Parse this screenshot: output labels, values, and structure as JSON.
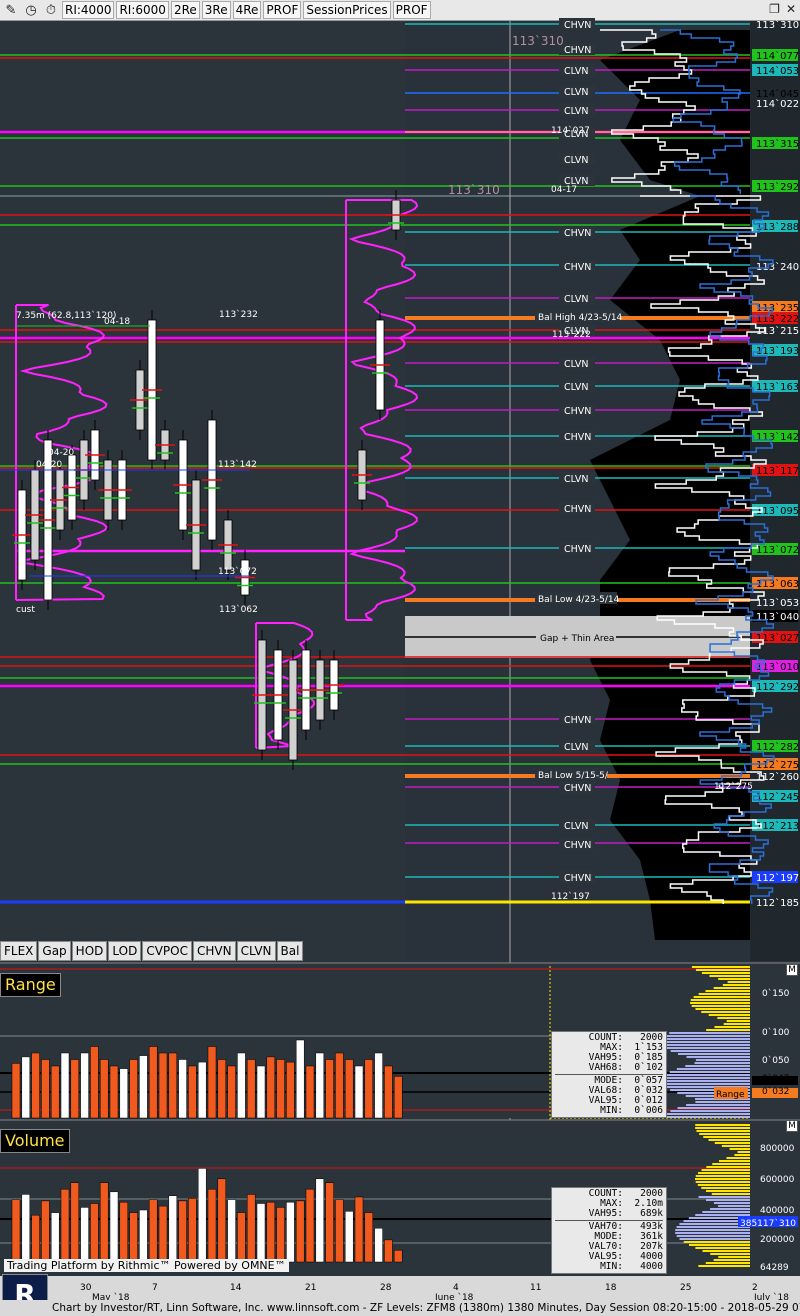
{
  "toolbar": {
    "buttons": [
      "RI:4000",
      "RI:6000",
      "2Re",
      "3Re",
      "4Re",
      "PROF",
      "SessionPrices",
      "PROF"
    ],
    "icons": [
      "pencil-icon",
      "clock-icon",
      "stopwatch-icon"
    ],
    "ri_badge": "RI"
  },
  "bottom_toolbar": [
    "FLEX",
    "Gap",
    "HOD",
    "LOD",
    "CVPOC",
    "CHVN",
    "CLVN",
    "Bal"
  ],
  "price_scale_labels": [
    {
      "t": "113`310",
      "c": "#ffffff",
      "bg": "#2b333b"
    },
    {
      "t": "114`077",
      "c": "#000",
      "bg": "#21c21c"
    },
    {
      "t": "114`053",
      "c": "#000",
      "bg": "#1fb8b8"
    },
    {
      "t": "114`045",
      "c": "#000",
      "bg": "#2b333b"
    },
    {
      "t": "114`022",
      "c": "#fff",
      "bg": "#2b333b"
    },
    {
      "t": "113`315",
      "c": "#000",
      "bg": "#21c21c"
    },
    {
      "t": "113`292",
      "c": "#000",
      "bg": "#21c21c"
    },
    {
      "t": "113`288",
      "c": "#000",
      "bg": "#1fb8b8"
    },
    {
      "t": "113`240",
      "c": "#fff",
      "bg": "#2b333b"
    },
    {
      "t": "113`235",
      "c": "#000",
      "bg": "#f47b1f"
    },
    {
      "t": "113`222",
      "c": "#000",
      "bg": "#e01212"
    },
    {
      "t": "113`215",
      "c": "#fff",
      "bg": "#2b333b"
    },
    {
      "t": "113`193",
      "c": "#000",
      "bg": "#1fb8b8"
    },
    {
      "t": "113`163",
      "c": "#000",
      "bg": "#1fb8b8"
    },
    {
      "t": "113`142",
      "c": "#000",
      "bg": "#21c21c"
    },
    {
      "t": "113`117",
      "c": "#000",
      "bg": "#e01212"
    },
    {
      "t": "113`095",
      "c": "#000",
      "bg": "#1fb8b8"
    },
    {
      "t": "113`072",
      "c": "#000",
      "bg": "#21c21c"
    },
    {
      "t": "113`063",
      "c": "#000",
      "bg": "#f47b1f"
    },
    {
      "t": "113`053",
      "c": "#fff",
      "bg": "#2b333b"
    },
    {
      "t": "113`040",
      "c": "#fff",
      "bg": "#000"
    },
    {
      "t": "113`027",
      "c": "#000",
      "bg": "#e01212"
    },
    {
      "t": "113`010",
      "c": "#000",
      "bg": "#e020e0"
    },
    {
      "t": "112`292",
      "c": "#000",
      "bg": "#1fb8b8"
    },
    {
      "t": "112`282",
      "c": "#000",
      "bg": "#21c21c"
    },
    {
      "t": "112`275",
      "c": "#000",
      "bg": "#f47b1f"
    },
    {
      "t": "112`260",
      "c": "#fff",
      "bg": "#2b333b"
    },
    {
      "t": "112`245",
      "c": "#000",
      "bg": "#1fb8b8"
    },
    {
      "t": "112`213",
      "c": "#000",
      "bg": "#1fb8b8"
    },
    {
      "t": "112`197",
      "c": "#fff",
      "bg": "#1a3cff"
    },
    {
      "t": "112`185",
      "c": "#fff",
      "bg": "#2b333b"
    }
  ],
  "annotations": {
    "poc_label": "7.35m (62.8,113`120)",
    "date_0418": "04-18",
    "date_0420a": "04-20",
    "date_0420b": "04-20",
    "high_232": "113`232",
    "level_142": "113`142",
    "level_072": "113`072",
    "level_062": "113`062",
    "cust": "cust",
    "top_310": "113`310",
    "mid_310": "113`310",
    "d0417": "04-17",
    "bal_high": "Bal High 4/23-5/14",
    "bal_low": "Bal Low 4/23-5/14",
    "gap_thin": "Gap + Thin Area",
    "bal_low2": "Bal Low 5/15-5/",
    "l222": "113`222",
    "l197": "112`197",
    "l275": "112`275",
    "l027": "114`027",
    "june": "June `18"
  },
  "chvn_labels": [
    "CHVN",
    "CHVN",
    "CLVN",
    "CLVN",
    "CLVN",
    "CLVN",
    "CLVN",
    "CLVN",
    "CHVN",
    "CHVN",
    "CLVN",
    "CLVN",
    "CLVN",
    "CLVN",
    "CHVN",
    "CHVN",
    "CLVN",
    "CHVN",
    "CHVN",
    "CHVN",
    "CLVN",
    "CHVN",
    "CLVN",
    "CHVN",
    "CHVN",
    "CLVN"
  ],
  "range_panel": {
    "title": "Range",
    "scale": [
      "0`150",
      "0`100",
      "0`050",
      "0`047",
      "0`032"
    ],
    "range_tag": "Range",
    "stats": [
      [
        "COUNT:",
        "2000"
      ],
      [
        "MAX:",
        "1`153"
      ],
      [
        "VAH95:",
        "0`185"
      ],
      [
        "VAH68:",
        "0`102"
      ],
      [
        "MODE:",
        "0`057"
      ],
      [
        "VAL68:",
        "0`032"
      ],
      [
        "VAL95:",
        "0`012"
      ],
      [
        "MIN:",
        "0`006"
      ]
    ]
  },
  "volume_panel": {
    "title": "Volume",
    "scale": [
      "800000",
      "600000",
      "400000",
      "200000",
      "64289"
    ],
    "right_value": "385117`310",
    "stats": [
      [
        "COUNT:",
        "2000"
      ],
      [
        "MAX:",
        "2.10m"
      ],
      [
        "VAH95:",
        "689k"
      ],
      [
        "VAH70:",
        "493k"
      ],
      [
        "MODE:",
        "361k"
      ],
      [
        "VAL70:",
        "207k"
      ],
      [
        "VAL95:",
        "4000"
      ],
      [
        "MIN:",
        "4000"
      ]
    ]
  },
  "x_axis": [
    "30",
    "May `18",
    "7",
    "14",
    "21",
    "28",
    "4",
    "June `18",
    "11",
    "18",
    "25",
    "2",
    "July `18"
  ],
  "branding": {
    "rithmic": "Trading Platform by Rithmic™  Powered by OMNE™",
    "logo": "R"
  },
  "footer": "Chart by Investor/RT, Linn Software, Inc. www.linnsoft.com - ZF Levels: ZFM8 (1380m) 1380 Minutes, Day Session 08:20-15:00 - 2018-05-29 07:49:42",
  "m_labels": [
    "M",
    "M"
  ],
  "chart_data": {
    "type": "bar",
    "range_bars": [
      0.042,
      0.047,
      0.05,
      0.045,
      0.04,
      0.05,
      0.045,
      0.05,
      0.055,
      0.045,
      0.04,
      0.038,
      0.045,
      0.048,
      0.055,
      0.05,
      0.05,
      0.045,
      0.04,
      0.043,
      0.055,
      0.045,
      0.04,
      0.05,
      0.045,
      0.04,
      0.047,
      0.045,
      0.043,
      0.06,
      0.04,
      0.05,
      0.045,
      0.05,
      0.045,
      0.04,
      0.045,
      0.05,
      0.04,
      0.032
    ],
    "volume_bars": [
      480,
      520,
      360,
      470,
      380,
      560,
      610,
      420,
      450,
      610,
      540,
      460,
      380,
      400,
      480,
      430,
      510,
      470,
      490,
      720,
      560,
      640,
      480,
      380,
      520,
      450,
      460,
      420,
      460,
      470,
      560,
      640,
      610,
      480,
      390,
      500,
      380,
      260,
      170,
      90
    ],
    "ylabel_range": "",
    "ylabel_volume": ""
  }
}
